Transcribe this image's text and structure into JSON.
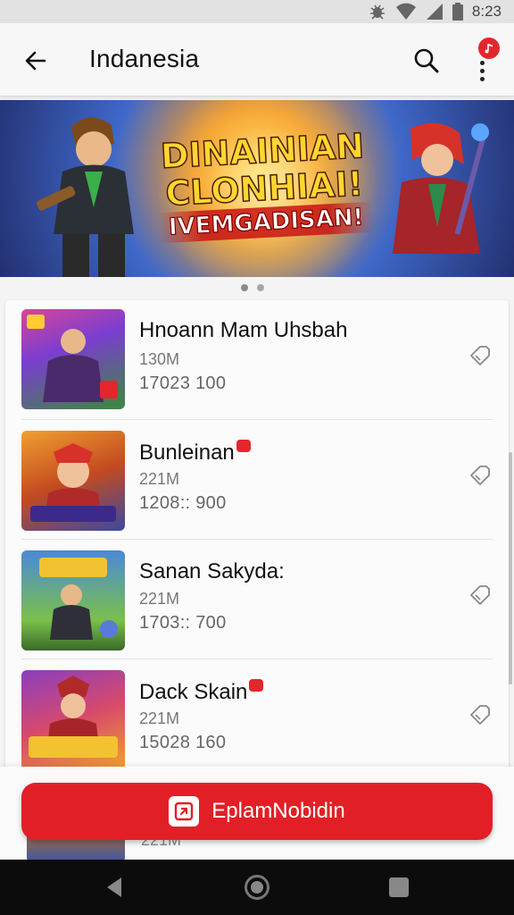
{
  "status_bar": {
    "time": "8:23",
    "icons": [
      "bug-icon",
      "wifi-icon",
      "signal-icon",
      "battery-icon"
    ]
  },
  "app_bar": {
    "title": "Indanesia",
    "back_icon": "arrow-left-icon",
    "search_icon": "search-icon",
    "more_icon": "more-vertical-icon",
    "notification_icon": "music-note-icon"
  },
  "banner": {
    "line1": "DINAINIAN",
    "line2": "CLONHIAI!",
    "line3": "IVEMGADISAN!",
    "page_count": 2,
    "active_page": 1
  },
  "games": [
    {
      "title": "Hnoann Mam Uhsbah",
      "size": "130M",
      "downloads": "17023 100",
      "badge": false,
      "action_icon": "tag-icon"
    },
    {
      "title": "Bunleinan",
      "size": "221M",
      "downloads": "1208:: 900",
      "badge": true,
      "action_icon": "tag-icon"
    },
    {
      "title": "Sanan Sakyda:",
      "size": "221M",
      "downloads": "1703:: 700",
      "badge": false,
      "action_icon": "tag-icon"
    },
    {
      "title": "Dack Skain",
      "size": "221M",
      "downloads": "15028 160",
      "badge": true,
      "action_icon": "tag-icon"
    }
  ],
  "peek_item": {
    "size": "221M"
  },
  "primary_action": {
    "label": "EplamNobidin",
    "icon": "install-icon"
  },
  "colors": {
    "accent": "#e21f26",
    "background": "#f4f4f4",
    "nav_bar": "#0c0c0c"
  }
}
